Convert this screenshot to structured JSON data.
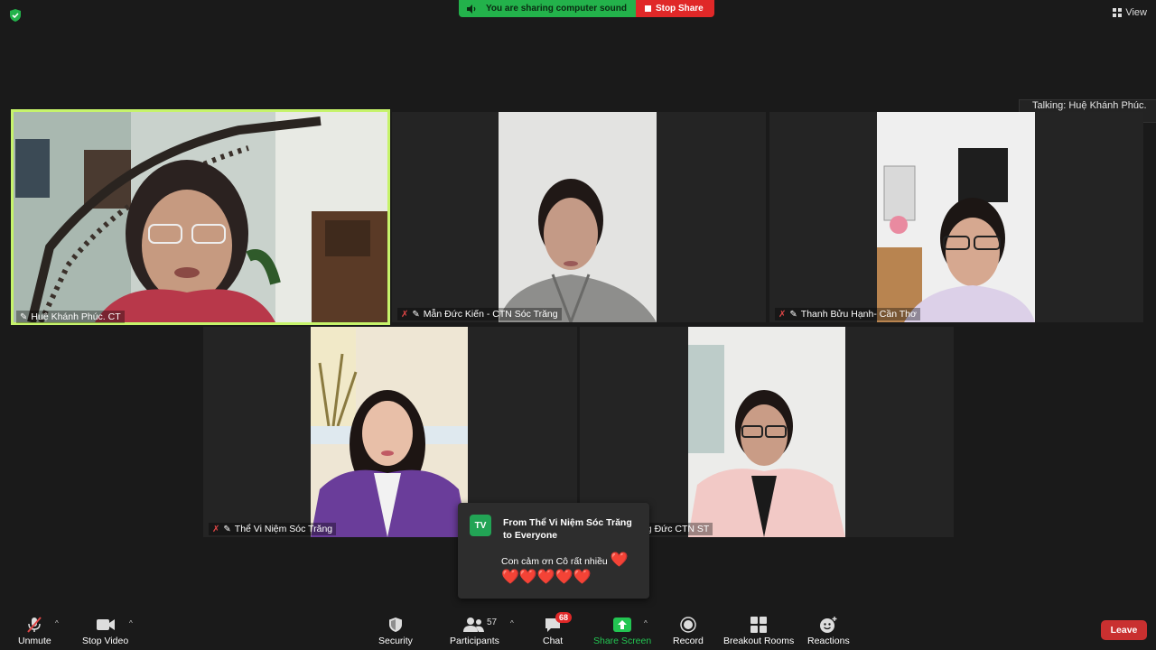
{
  "top": {
    "sharing_sound": "You are sharing computer sound",
    "stop_share": "Stop Share",
    "view": "View"
  },
  "talking": "Talking: Huệ Khánh Phúc. CT",
  "participants": [
    {
      "name": "Huệ Khánh Phúc. CT",
      "muted": false,
      "active": true
    },
    {
      "name": "Mẫn Đức Kiến - CTN Sóc Trăng",
      "muted": true,
      "active": false
    },
    {
      "name": "Thanh Bửu Hạnh- Cần Thơ",
      "muted": true,
      "active": false
    },
    {
      "name": "Thể Vi Niệm Sóc Trăng",
      "muted": true,
      "active": false
    },
    {
      "name": "ng Đức CTN ST",
      "muted": false,
      "active": false
    }
  ],
  "chat_popup": {
    "avatar": "TV",
    "from": "From Thể Vi Niệm Sóc Trăng to Everyone",
    "message": "Con cảm ơn Cô rất nhiều",
    "hearts_line1": "❤️",
    "hearts_line2": "❤️❤️❤️❤️❤️"
  },
  "toolbar": {
    "unmute": "Unmute",
    "stop_video": "Stop Video",
    "security": "Security",
    "participants": "Participants",
    "participants_count": "57",
    "chat": "Chat",
    "chat_badge": "68",
    "share_screen": "Share Screen",
    "record": "Record",
    "breakout_rooms": "Breakout Rooms",
    "reactions": "Reactions",
    "leave": "Leave"
  },
  "colors": {
    "active_speaker": "#c6f36b",
    "share_green": "#23b24b",
    "stop_red": "#e02828",
    "leave_red": "#c93030"
  }
}
